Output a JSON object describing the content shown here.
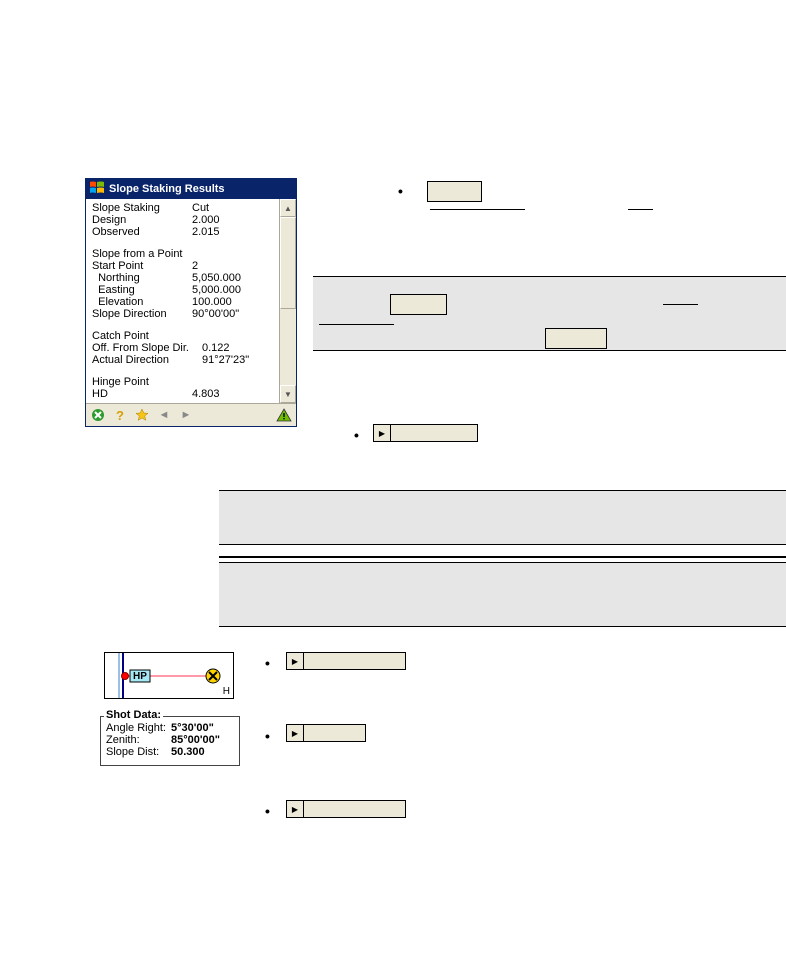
{
  "window": {
    "title": "Slope Staking Results"
  },
  "results": {
    "slope_staking_label": "Slope Staking",
    "slope_staking_value": "Cut",
    "design_label": "Design",
    "design_value": "2.000",
    "observed_label": "Observed",
    "observed_value": "2.015",
    "slope_point_header": "Slope from a Point",
    "start_point_label": "Start Point",
    "start_point_value": "2",
    "northing_label": "  Northing",
    "northing_value": "5,050.000",
    "easting_label": "  Easting",
    "easting_value": "5,000.000",
    "elevation_label": "  Elevation",
    "elevation_value": "100.000",
    "slope_dir_label": "Slope Direction",
    "slope_dir_value": "90°00'00\"",
    "catch_point_header": "Catch Point",
    "off_label": "Off. From Slope Dir.",
    "off_value": "0.122",
    "actual_dir_label": "Actual Direction",
    "actual_dir_value": "91°27'23\"",
    "hinge_point_header": "Hinge Point",
    "hd_label": "HD",
    "hd_value": "4.803"
  },
  "toolbar_icons": {
    "close": "close-icon",
    "help": "help-icon",
    "star": "star-icon",
    "left": "chevron-left-icon",
    "right": "chevron-right-icon",
    "warn": "warning-icon"
  },
  "diagram": {
    "hp_label": "HP",
    "h_label": "H"
  },
  "shot_data": {
    "legend": "Shot Data:",
    "angle_right_label": "Angle Right:",
    "angle_right_value": "5°30'00\"",
    "zenith_label": "Zenith:",
    "zenith_value": "85°00'00\"",
    "slope_dist_label": "Slope Dist:",
    "slope_dist_value": "50.300"
  }
}
